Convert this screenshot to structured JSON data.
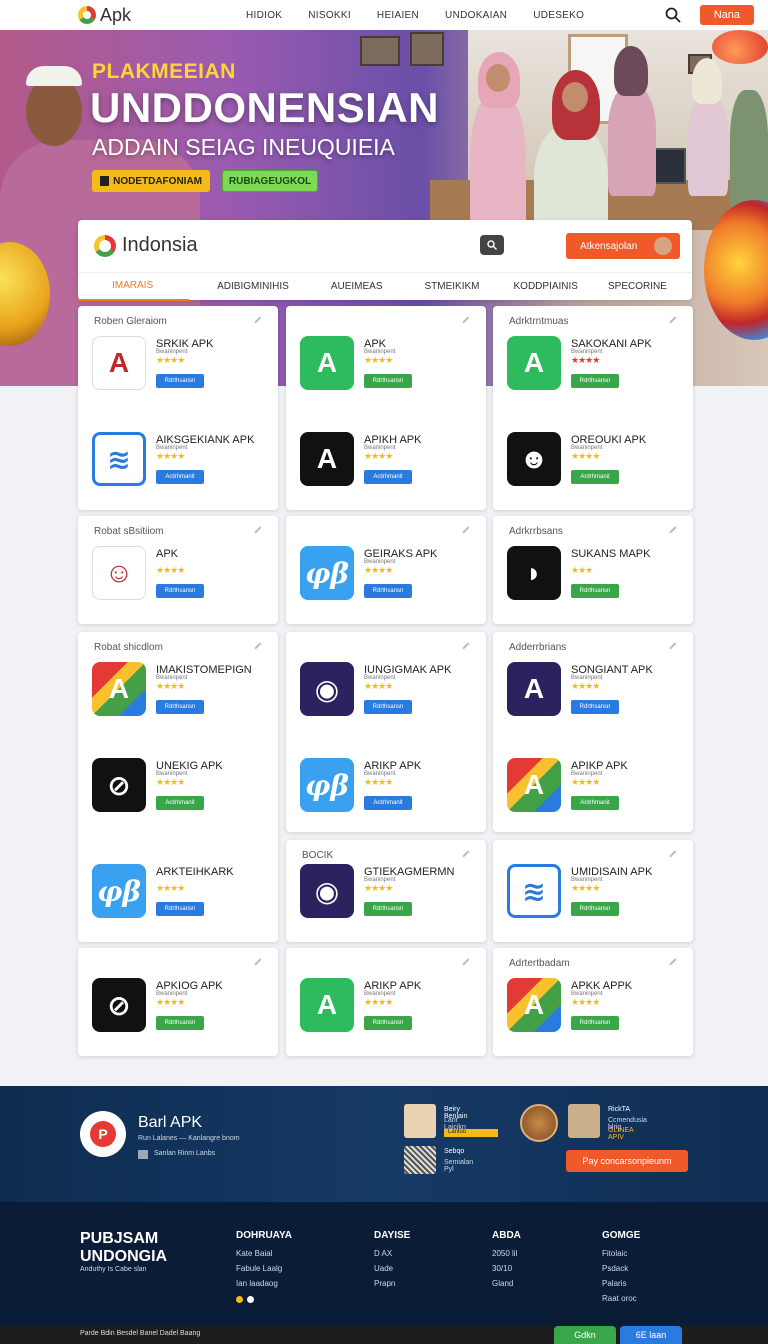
{
  "nav": {
    "logo": "Apk",
    "links": [
      "HIDIOK",
      "NISOKKI",
      "HEIAIEN",
      "UNDOKAIAN",
      "UDESEKO"
    ],
    "cta": "Nana"
  },
  "hero": {
    "kicker": "PLAKMEEIAN",
    "title": "UNDDONENSIAN",
    "subtitle": "ADDAIN SEIAG INEUQUIEIA",
    "btn_primary": "NODETDAFONIAM",
    "btn_secondary": "RUBIAGEUGKOL"
  },
  "store": {
    "brand": "Indonsia",
    "cta": "Atkensajolan",
    "tabs": [
      "IMARAIS",
      "ADIBIGMINIHIS",
      "AUEIMEAS",
      "STMEIKIKM",
      "KODDPIAINIS",
      "SPECORINE"
    ]
  },
  "cards": [
    {
      "title": "Roben Gleraiom",
      "items": [
        {
          "name": "SRKIK APK",
          "sub": "Bwaninpent",
          "stars": "★★★★",
          "dl": "Rdrthsansn",
          "dlc": "blue",
          "icon": "A",
          "style": "ic-yellowA"
        },
        {
          "name": "AIKSGEKIANK APK",
          "sub": "Bwaninpent",
          "stars": "★★★★",
          "dl": "Ardrhmanit",
          "dlc": "blue",
          "icon": "≋",
          "style": "ic-blue"
        }
      ]
    },
    {
      "title": "",
      "items": [
        {
          "name": "APK",
          "sub": "Bwaninpent",
          "stars": "★★★★",
          "dl": "Rdrthsansn",
          "dlc": "green",
          "icon": "A",
          "style": "ic-green"
        },
        {
          "name": "APIKH APK",
          "sub": "Bwaninpent",
          "stars": "★★★★",
          "dl": "Ardrhmanit",
          "dlc": "blue",
          "icon": "A",
          "style": "ic-dark"
        }
      ]
    },
    {
      "title": "Adrktrntmuas",
      "items": [
        {
          "name": "SAKOKANI APK",
          "sub": "Bwaninpent",
          "stars": "★★★★",
          "dl": "Rdrthsansn",
          "dlc": "green",
          "icon": "A",
          "style": "ic-green",
          "red": true
        },
        {
          "name": "OREOUKI APK",
          "sub": "Bwaninpent",
          "stars": "★★★★",
          "dl": "Ardrhmanit",
          "dlc": "green",
          "icon": "☻",
          "style": "ic-dark"
        }
      ]
    },
    {
      "title": "Robat sBsitiiom",
      "items": [
        {
          "name": "APK",
          "sub": "",
          "stars": "★★★★",
          "dl": "Rdrthsansn",
          "dlc": "blue",
          "icon": "☺",
          "style": "ic-yellowA"
        }
      ]
    },
    {
      "title": "",
      "items": [
        {
          "name": "GEIRAKS APK",
          "sub": "Bwaninpent",
          "stars": "★★★★",
          "dl": "Rdrthsansn",
          "dlc": "blue",
          "icon": "φβ",
          "style": "ic-sky"
        }
      ]
    },
    {
      "title": "Adrkrrbsans",
      "items": [
        {
          "name": "SUKANS MAPK",
          "sub": "",
          "stars": "★★★",
          "dl": "Rdrthsansn",
          "dlc": "green",
          "icon": "◗",
          "style": "ic-dark"
        }
      ]
    },
    {
      "title": "Robat shicdlom",
      "items": [
        {
          "name": "IMAKISTOMEPIGN",
          "sub": "Bwaninpent",
          "stars": "★★★★",
          "dl": "Rdrthsansn",
          "dlc": "blue",
          "icon": "A",
          "style": "ic-multi"
        },
        {
          "name": "UNEKIG APK",
          "sub": "Bwaninpent",
          "stars": "★★★★",
          "dl": "Ardrhmanit",
          "dlc": "green",
          "icon": "⊘",
          "style": "ic-dark"
        },
        {
          "name": "ARKTEIHKARK",
          "sub": "",
          "stars": "★★★★",
          "dl": "Rdrthsansn",
          "dlc": "blue",
          "icon": "φβ",
          "style": "ic-sky"
        }
      ]
    },
    {
      "title": "",
      "items": [
        {
          "name": "IUNGIGMAK APK",
          "sub": "Bwaninpent",
          "stars": "★★★★",
          "dl": "Rdrthsansn",
          "dlc": "blue",
          "icon": "◉",
          "style": "ic-purple"
        },
        {
          "name": "ARIKP APK",
          "sub": "Bwaninpent",
          "stars": "★★★★",
          "dl": "Ardrhmanit",
          "dlc": "blue",
          "icon": "φβ",
          "style": "ic-sky"
        }
      ]
    },
    {
      "title": "Adderrbrians",
      "items": [
        {
          "name": "SONGIANT APK",
          "sub": "Bwaninpent",
          "stars": "★★★★",
          "dl": "Rdrthsansn",
          "dlc": "blue",
          "icon": "A",
          "style": "ic-purple"
        },
        {
          "name": "APIKP APK",
          "sub": "Bwaninpent",
          "stars": "★★★★",
          "dl": "Ardrhmanit",
          "dlc": "green",
          "icon": "A",
          "style": "ic-multi"
        }
      ]
    },
    {
      "title": "BOCIK",
      "items": [
        {
          "name": "GTIEKAGMERMN",
          "sub": "Bwaninpent",
          "stars": "★★★★",
          "dl": "Rdrthsansn",
          "dlc": "green",
          "icon": "◉",
          "style": "ic-purple"
        }
      ]
    },
    {
      "title": "",
      "items": [
        {
          "name": "UMIDISAIN APK",
          "sub": "Bwaninpent",
          "stars": "★★★★",
          "dl": "Rdrthsansn",
          "dlc": "green",
          "icon": "≋",
          "style": "ic-blue"
        }
      ]
    },
    {
      "title": "",
      "items": [
        {
          "name": "APKIOG APK",
          "sub": "Bwaninpent",
          "stars": "★★★★",
          "dl": "Rdrthsansn",
          "dlc": "green",
          "icon": "⊘",
          "style": "ic-dark"
        }
      ]
    },
    {
      "title": "",
      "items": [
        {
          "name": "ARIKP APK",
          "sub": "Bwaninpent",
          "stars": "★★★★",
          "dl": "Rdrthsansn",
          "dlc": "green",
          "icon": "A",
          "style": "ic-green"
        }
      ]
    },
    {
      "title": "Adrtertbadam",
      "items": [
        {
          "name": "APKK APPK",
          "sub": "Bwaninpent",
          "stars": "★★★★",
          "dl": "Rdrthsansn",
          "dlc": "green",
          "icon": "A",
          "style": "ic-multi"
        }
      ]
    }
  ],
  "promo": {
    "logo": "P",
    "title": "Barl APK",
    "sub": "Run Lalanes  —  Kanlangre bnom",
    "sub2": "Sanlan Rinm Lanbs",
    "c1_l1": "Beiry Benlain",
    "c1_l2": "Lanr Laicikn",
    "c1_bar": "Lanluo",
    "c2_l1": "Sebqo",
    "c2_l2": "Semialan Pyl",
    "c3_l1": "RickTA",
    "c3_l2": "Ccmendusia blrig",
    "c3_l3": "GLINEA APIV",
    "cta": "Pay concarsonpieunm"
  },
  "footer": {
    "brand": "PUBJSAM UNDONGIA",
    "tag": "Anduthy Is Cabe slan",
    "col1": {
      "title": "DOHRUAYA",
      "items": [
        "Kate Baial",
        "Fabule Laalg",
        "Ian laadaog"
      ]
    },
    "col2": {
      "title": "DAYISE",
      "items": [
        "D AX",
        "Uade",
        "Prapn"
      ]
    },
    "col3": {
      "title": "ABDA",
      "items": [
        "2050 lil",
        "30/10",
        "Gland"
      ]
    },
    "col4": {
      "title": "GOMGE",
      "items": [
        "Fitolaic",
        "Psdack",
        "Palaris",
        "Raat oroc"
      ]
    },
    "bottom": "Parde Bdin  Besdel Banel  Dadel Baang",
    "btn1": "Gdkn",
    "btn2": "6E laan"
  },
  "colors": {
    "accent": "#f05a2a",
    "navy": "#0d2c4f",
    "green": "#3aa64a",
    "blue": "#2a7be0"
  }
}
